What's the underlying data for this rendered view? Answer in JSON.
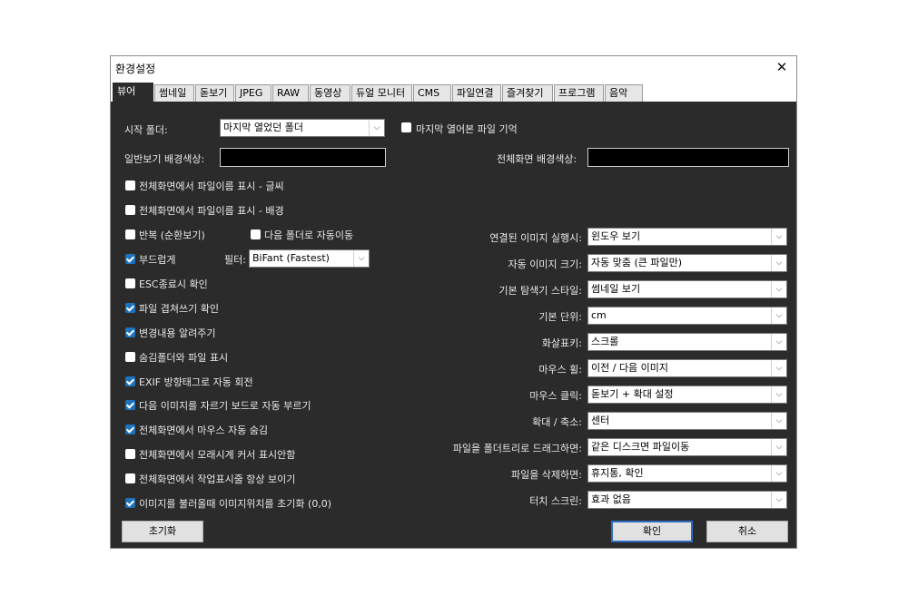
{
  "window": {
    "title": "환경설정"
  },
  "tabs": [
    "뷰어",
    "썸네일",
    "돋보기",
    "JPEG",
    "RAW",
    "동영상",
    "듀얼 모니터",
    "CMS",
    "파일연결",
    "즐겨찾기",
    "프로그램",
    "음악"
  ],
  "viewer": {
    "start_folder_label": "시작 폴더:",
    "start_folder_value": "마지막 열었던 폴더",
    "remember_last_file_label": "마지막 열어본 파일 기억",
    "remember_last_file": false,
    "normal_bg_label": "일반보기 배경색상:",
    "fullscreen_bg_label": "전체화면 배경색상:",
    "normal_bg_color": "#000000",
    "fullscreen_bg_color": "#000000",
    "filter_label": "필터:",
    "filter_value": "BiFant (Fastest)",
    "next_folder_label": "다음 폴더로 자동이동",
    "next_folder": false
  },
  "left_options": [
    {
      "label": "전체화면에서 파일이름 표시 - 글씨",
      "checked": false
    },
    {
      "label": "전체화면에서 파일이름 표시 - 배경",
      "checked": false
    },
    {
      "label": "반복 (순환보기)",
      "checked": false
    },
    {
      "label": "부드럽게",
      "checked": true
    },
    {
      "label": "ESC종료시 확인",
      "checked": false
    },
    {
      "label": "파일 겹쳐쓰기 확인",
      "checked": true
    },
    {
      "label": "변경내용 알려주기",
      "checked": true
    },
    {
      "label": "숨김폴더와 파일 표시",
      "checked": false
    },
    {
      "label": "EXIF 방향태그로 자동 회전",
      "checked": true
    },
    {
      "label": "다음 이미지를 자르기 보드로 자동 부르기",
      "checked": true
    },
    {
      "label": "전체화면에서 마우스 자동 숨김",
      "checked": true
    },
    {
      "label": "전체화면에서 모래시계 커서 표시안함",
      "checked": false
    },
    {
      "label": "전체화면에서 작업표시줄 항상 보이기",
      "checked": false
    },
    {
      "label": "이미지를 불러올때 이미지위치를 초기화 (0,0)",
      "checked": true
    }
  ],
  "right_options": [
    {
      "label": "연결된 이미지 실행시:",
      "value": "윈도우 보기"
    },
    {
      "label": "자동 이미지 크기:",
      "value": "자동 맞춤 (큰 파일만)"
    },
    {
      "label": "기본 탐색기 스타일:",
      "value": "썸네일 보기"
    },
    {
      "label": "기본 단위:",
      "value": "cm"
    },
    {
      "label": "화살표키:",
      "value": "스크롤"
    },
    {
      "label": "마우스 휠:",
      "value": "이전 / 다음 이미지"
    },
    {
      "label": "마우스 클릭:",
      "value": "돋보기 + 확대 설정"
    },
    {
      "label": "확대 / 축소:",
      "value": "센터"
    },
    {
      "label": "파일을 폴더트리로 드래그하면:",
      "value": "같은 디스크면 파일이동"
    },
    {
      "label": "파일을 삭제하면:",
      "value": "휴지통, 확인"
    },
    {
      "label": "터치 스크린:",
      "value": "효과 없음"
    }
  ],
  "buttons": {
    "reset": "초기화",
    "ok": "확인",
    "cancel": "취소"
  },
  "icons": {
    "close": "close-icon",
    "dropdown": "chevron-down-icon"
  }
}
